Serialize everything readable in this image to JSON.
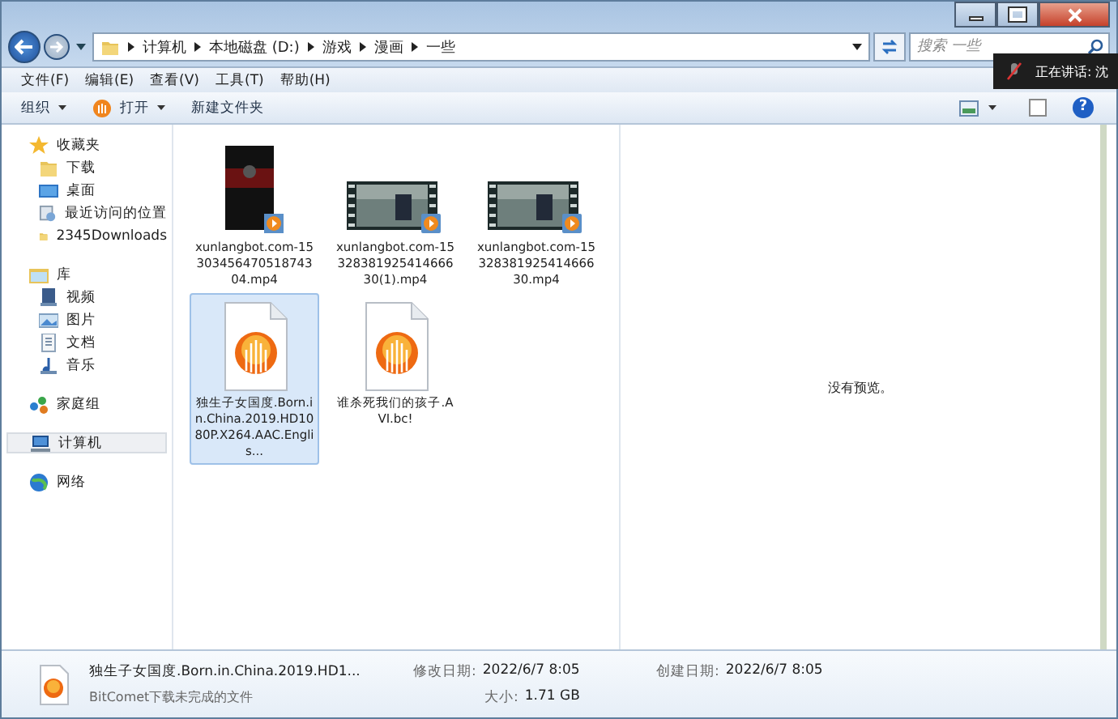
{
  "address": {
    "crumbs": [
      "计算机",
      "本地磁盘 (D:)",
      "游戏",
      "漫画",
      "一些"
    ]
  },
  "search": {
    "placeholder": "搜索 一些"
  },
  "call_overlay": {
    "text": "正在讲话: 沈"
  },
  "menu": [
    "文件(F)",
    "编辑(E)",
    "查看(V)",
    "工具(T)",
    "帮助(H)"
  ],
  "toolbar": [
    {
      "label": "组织",
      "kind": "dropdown"
    },
    {
      "label": "打开",
      "kind": "open"
    },
    {
      "label": "新建文件夹",
      "kind": "plain"
    }
  ],
  "help_button": {
    "label": "?"
  },
  "sidebar": {
    "groups": [
      {
        "label": "收藏夹",
        "selected": false,
        "children": [
          {
            "label": "下载",
            "selected": false
          },
          {
            "label": "桌面",
            "selected": false
          },
          {
            "label": "最近访问的位置",
            "selected": false
          },
          {
            "label": "2345Downloads",
            "selected": false
          }
        ]
      },
      {
        "label": "库",
        "selected": false,
        "children": [
          {
            "label": "视频",
            "selected": false
          },
          {
            "label": "图片",
            "selected": false
          },
          {
            "label": "文档",
            "selected": false
          },
          {
            "label": "音乐",
            "selected": false
          }
        ]
      },
      {
        "label": "家庭组",
        "selected": false
      },
      {
        "label": "计算机",
        "selected": true
      },
      {
        "label": "网络",
        "selected": false
      }
    ]
  },
  "files": [
    {
      "name": "xunlangbot.com-1530345647051874304.mp4",
      "kind": "portrait-video",
      "selected": false
    },
    {
      "name": "xunlangbot.com-1532838192541466630(1).mp4",
      "kind": "video",
      "selected": false
    },
    {
      "name": "xunlangbot.com-1532838192541466630.mp4",
      "kind": "video",
      "selected": false
    },
    {
      "name": "独生子女国度.Born.in.China.2019.HD1080P.X264.AAC.Englis...",
      "kind": "bitcomet",
      "selected": true
    },
    {
      "name": "谁杀死我们的孩子.AVI.bc!",
      "kind": "bitcomet",
      "selected": false
    }
  ],
  "preview": {
    "text": "没有预览。"
  },
  "details": {
    "name": "独生子女国度.Born.in.China.2019.HD1...",
    "type": "BitComet下载未完成的文件",
    "fields": [
      {
        "label": "修改日期:",
        "value": "2022/6/7 8:05"
      },
      {
        "label": "创建日期:",
        "value": "2022/6/7 8:05"
      },
      {
        "label": "大小:",
        "value": "1.71 GB"
      }
    ]
  }
}
